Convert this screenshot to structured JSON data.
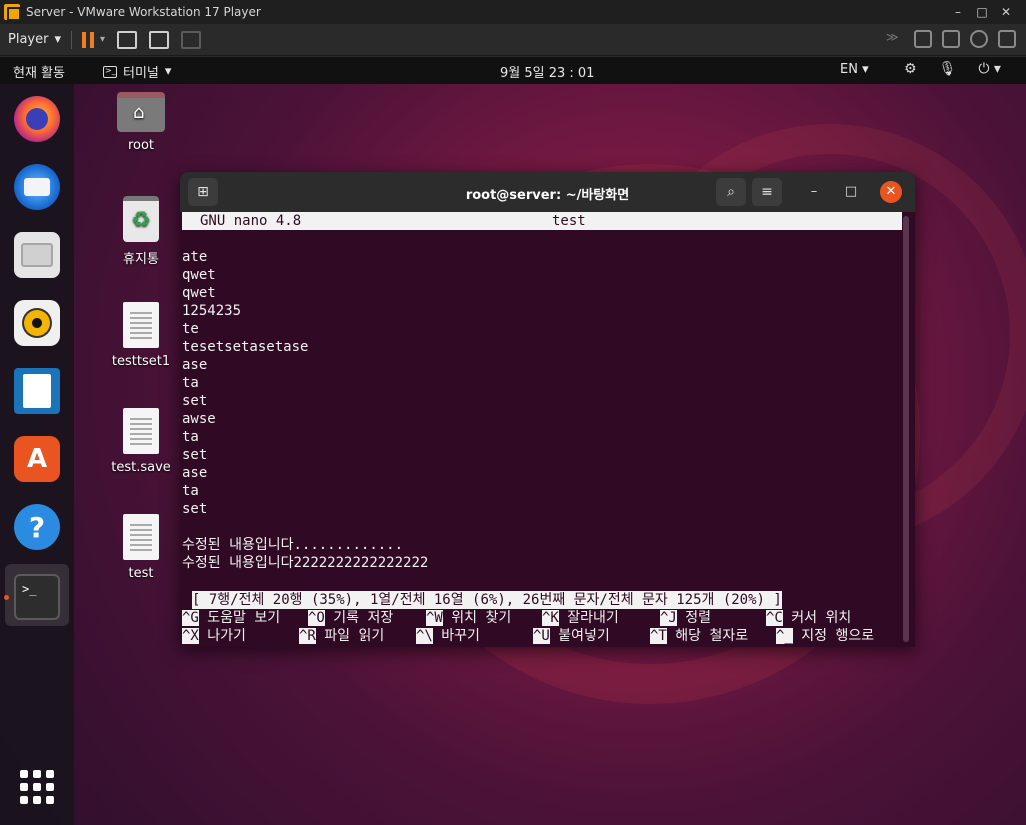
{
  "vmware": {
    "title": "Server - VMware Workstation 17 Player",
    "player_label": "Player",
    "window_controls": [
      "–",
      "□",
      "✕"
    ]
  },
  "ubuntu_topbar": {
    "activities": "현재 활동",
    "app_menu": "터미널",
    "clock": "9월 5일  23 : 01",
    "language": "EN"
  },
  "dock": {
    "items": [
      "firefox",
      "thunderbird",
      "files",
      "rhythmbox",
      "libreoffice-writer",
      "ubuntu-software",
      "help",
      "terminal"
    ]
  },
  "desktop_icons": [
    {
      "label": "root",
      "icon": "home-folder-icon"
    },
    {
      "label": "휴지통",
      "icon": "trash-icon"
    },
    {
      "label": "testtset1",
      "icon": "document-icon"
    },
    {
      "label": "test.save",
      "icon": "document-icon"
    },
    {
      "label": "test",
      "icon": "document-icon"
    }
  ],
  "terminal": {
    "title": "root@server: ~/바탕화면",
    "nano": {
      "version": "GNU nano 4.8",
      "filename": "test",
      "lines": [
        "",
        "ate",
        "qwet",
        "qwet",
        "1254235",
        "te",
        "tesetsetasetase",
        "ase",
        "ta",
        "set",
        "awse",
        "ta",
        "set",
        "ase",
        "ta",
        "set",
        "",
        "수정된 내용입니다.............",
        "수정된 내용입니다2222222222222222"
      ],
      "status": "[ 7행/전체 20행 (35%), 1열/전체 16열 (6%), 26번째 문자/전체 문자 125개 (20%) ]",
      "shortcuts_row1": [
        {
          "key": "^G",
          "label": "도움말 보기"
        },
        {
          "key": "^O",
          "label": "기록 저장"
        },
        {
          "key": "^W",
          "label": "위치 찾기"
        },
        {
          "key": "^K",
          "label": "잘라내기"
        },
        {
          "key": "^J",
          "label": "정렬"
        },
        {
          "key": "^C",
          "label": "커서 위치"
        }
      ],
      "shortcuts_row2": [
        {
          "key": "^X",
          "label": "나가기"
        },
        {
          "key": "^R",
          "label": "파일 읽기"
        },
        {
          "key": "^\\",
          "label": "바꾸기"
        },
        {
          "key": "^U",
          "label": "붙여넣기"
        },
        {
          "key": "^T",
          "label": "해당 철자로"
        },
        {
          "key": "^_",
          "label": "지정 행으로"
        }
      ]
    }
  },
  "colors": {
    "ubuntu_orange": "#e95420",
    "terminal_bg": "#300a24"
  }
}
